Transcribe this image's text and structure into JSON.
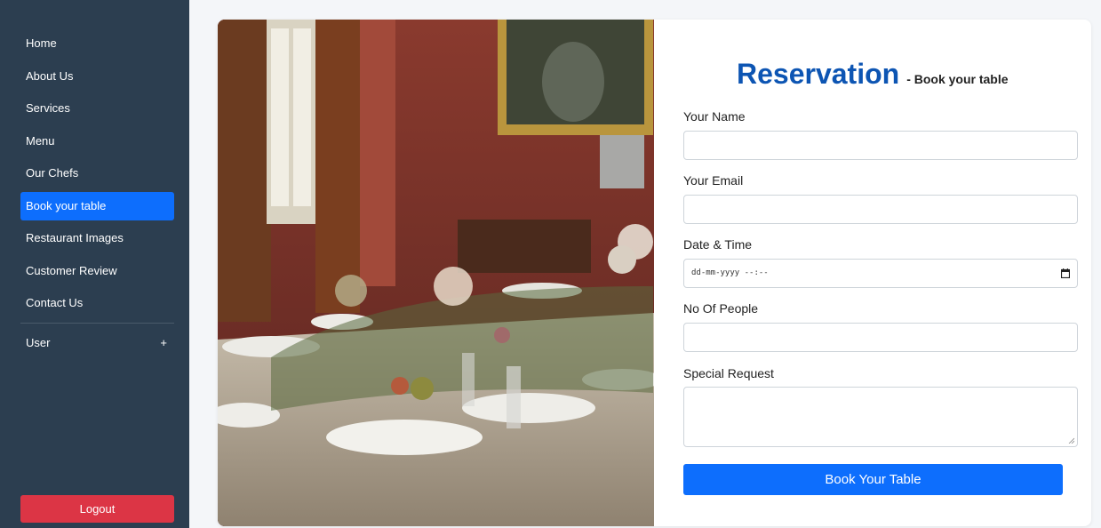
{
  "sidebar": {
    "items": [
      {
        "label": "Home"
      },
      {
        "label": "About Us"
      },
      {
        "label": "Services"
      },
      {
        "label": "Menu"
      },
      {
        "label": "Our Chefs"
      },
      {
        "label": "Book your table",
        "active": true
      },
      {
        "label": "Restaurant Images"
      },
      {
        "label": "Customer Review"
      },
      {
        "label": "Contact Us"
      }
    ],
    "user_label": "User",
    "user_toggle": "+",
    "logout_label": "Logout"
  },
  "reservation": {
    "title": "Reservation",
    "subtitle": "- Book your table",
    "fields": {
      "name_label": "Your Name",
      "email_label": "Your Email",
      "datetime_label": "Date & Time",
      "datetime_value": "dd-mm-yyyy --:--",
      "people_label": "No Of People",
      "request_label": "Special Request"
    },
    "submit_label": "Book Your Table"
  },
  "colors": {
    "sidebar_bg": "#2c3e50",
    "active": "#0d6efd",
    "logout": "#dc3545",
    "title": "#0d55b3"
  }
}
